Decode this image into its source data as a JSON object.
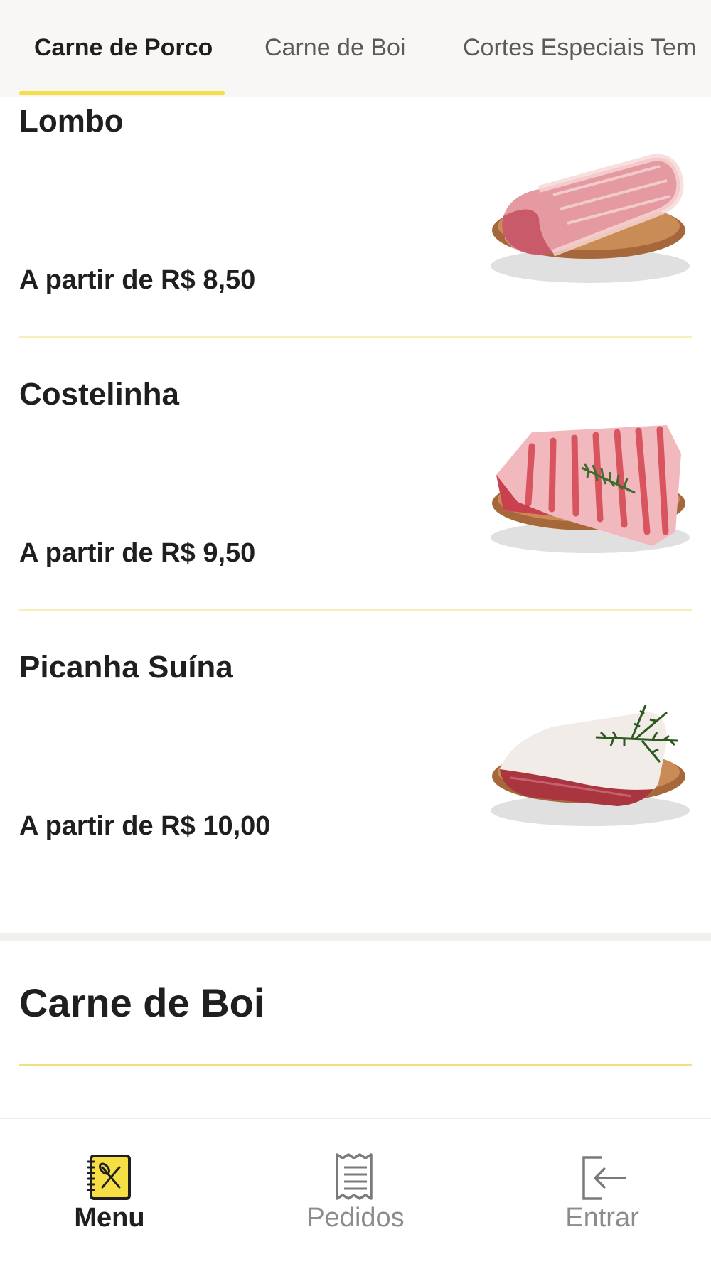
{
  "tabs": [
    {
      "label": "Carne de Porco",
      "active": true
    },
    {
      "label": "Carne de Boi",
      "active": false
    },
    {
      "label": "Cortes Especiais Tem",
      "active": false
    }
  ],
  "products": [
    {
      "name": "Lombo",
      "price": "A partir de R$ 8,50",
      "image": "pork-loin-on-wooden-plate"
    },
    {
      "name": "Costelinha",
      "price": "A partir de R$ 9,50",
      "image": "pork-ribs-with-rosemary"
    },
    {
      "name": "Picanha Suína",
      "price": "A partir de R$ 10,00",
      "image": "pork-picanha-with-rosemary"
    }
  ],
  "next_section": {
    "title": "Carne de Boi"
  },
  "bottom_nav": [
    {
      "label": "Menu",
      "icon": "menu-book-icon",
      "active": true
    },
    {
      "label": "Pedidos",
      "icon": "receipt-icon",
      "active": false
    },
    {
      "label": "Entrar",
      "icon": "login-icon",
      "active": false
    }
  ],
  "colors": {
    "accent": "#f5df45",
    "active_text": "#1f1f1f",
    "inactive_text": "#8c8c8c",
    "tabbar_bg": "#f8f7f5"
  }
}
